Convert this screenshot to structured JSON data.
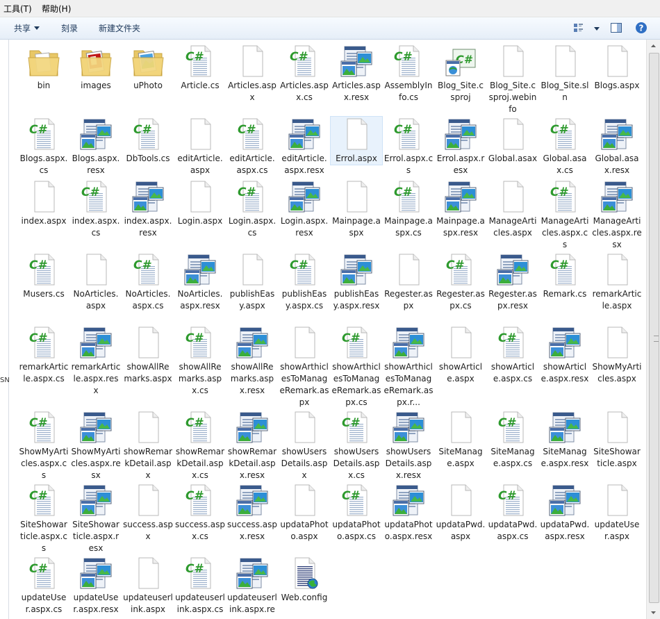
{
  "menu": {
    "tools": "工具(T)",
    "help": "帮助(H)"
  },
  "toolbar": {
    "share": "共享",
    "burn": "刻录",
    "new_folder": "新建文件夹"
  },
  "left_cut_text": "SN",
  "files": [
    {
      "name": "bin",
      "type": "folder"
    },
    {
      "name": "images",
      "type": "folder-images"
    },
    {
      "name": "uPhoto",
      "type": "folder-photo"
    },
    {
      "name": "Article.cs",
      "type": "cs"
    },
    {
      "name": "Articles.aspx",
      "type": "blank"
    },
    {
      "name": "Articles.aspx.cs",
      "type": "cs"
    },
    {
      "name": "Articles.aspx.resx",
      "type": "resx"
    },
    {
      "name": "AssemblyInfo.cs",
      "type": "cs"
    },
    {
      "name": "Blog_Site.csproj",
      "type": "csproj"
    },
    {
      "name": "Blog_Site.csproj.webinfo",
      "type": "blank"
    },
    {
      "name": "Blog_Site.sln",
      "type": "blank"
    },
    {
      "name": "Blogs.aspx",
      "type": "blank"
    },
    {
      "name": "Blogs.aspx.cs",
      "type": "cs"
    },
    {
      "name": "Blogs.aspx.resx",
      "type": "resx"
    },
    {
      "name": "DbTools.cs",
      "type": "cs"
    },
    {
      "name": "editArticle.aspx",
      "type": "blank"
    },
    {
      "name": "editArticle.aspx.cs",
      "type": "cs"
    },
    {
      "name": "editArticle.aspx.resx",
      "type": "resx"
    },
    {
      "name": "Errol.aspx",
      "type": "blank",
      "selected": true
    },
    {
      "name": "Errol.aspx.cs",
      "type": "cs"
    },
    {
      "name": "Errol.aspx.resx",
      "type": "resx"
    },
    {
      "name": "Global.asax",
      "type": "blank"
    },
    {
      "name": "Global.asax.cs",
      "type": "cs"
    },
    {
      "name": "Global.asax.resx",
      "type": "resx"
    },
    {
      "name": "index.aspx",
      "type": "blank"
    },
    {
      "name": "index.aspx.cs",
      "type": "cs"
    },
    {
      "name": "index.aspx.resx",
      "type": "resx"
    },
    {
      "name": "Login.aspx",
      "type": "blank"
    },
    {
      "name": "Login.aspx.cs",
      "type": "cs"
    },
    {
      "name": "Login.aspx.resx",
      "type": "resx"
    },
    {
      "name": "Mainpage.aspx",
      "type": "blank"
    },
    {
      "name": "Mainpage.aspx.cs",
      "type": "cs"
    },
    {
      "name": "Mainpage.aspx.resx",
      "type": "resx"
    },
    {
      "name": "ManageArticles.aspx",
      "type": "blank"
    },
    {
      "name": "ManageArticles.aspx.cs",
      "type": "cs"
    },
    {
      "name": "ManageArticles.aspx.resx",
      "type": "resx"
    },
    {
      "name": "Musers.cs",
      "type": "cs"
    },
    {
      "name": "NoArticles.aspx",
      "type": "blank"
    },
    {
      "name": "NoArticles.aspx.cs",
      "type": "cs"
    },
    {
      "name": "NoArticles.aspx.resx",
      "type": "resx"
    },
    {
      "name": "publishEasy.aspx",
      "type": "blank"
    },
    {
      "name": "publishEasy.aspx.cs",
      "type": "cs"
    },
    {
      "name": "publishEasy.aspx.resx",
      "type": "resx"
    },
    {
      "name": "Regester.aspx",
      "type": "blank"
    },
    {
      "name": "Regester.aspx.cs",
      "type": "cs"
    },
    {
      "name": "Regester.aspx.resx",
      "type": "resx"
    },
    {
      "name": "Remark.cs",
      "type": "cs"
    },
    {
      "name": "remarkArticle.aspx",
      "type": "blank"
    },
    {
      "name": "remarkArticle.aspx.cs",
      "type": "cs"
    },
    {
      "name": "remarkArticle.aspx.resx",
      "type": "resx"
    },
    {
      "name": "showAllRemarks.aspx",
      "type": "blank"
    },
    {
      "name": "showAllRemarks.aspx.cs",
      "type": "cs"
    },
    {
      "name": "showAllRemarks.aspx.resx",
      "type": "resx"
    },
    {
      "name": "showArthiclesToManageRemark.aspx",
      "type": "blank"
    },
    {
      "name": "showArthiclesToManageRemark.aspx.cs",
      "type": "cs"
    },
    {
      "name": "showArthiclesToManageRemark.aspx.r...",
      "type": "resx"
    },
    {
      "name": "showArticle.aspx",
      "type": "blank"
    },
    {
      "name": "showArticle.aspx.cs",
      "type": "cs"
    },
    {
      "name": "showArticle.aspx.resx",
      "type": "resx"
    },
    {
      "name": "ShowMyArticles.aspx",
      "type": "blank"
    },
    {
      "name": "ShowMyArticles.aspx.cs",
      "type": "cs"
    },
    {
      "name": "ShowMyArticles.aspx.resx",
      "type": "resx"
    },
    {
      "name": "showRemarkDetail.aspx",
      "type": "blank"
    },
    {
      "name": "showRemarkDetail.aspx.cs",
      "type": "cs"
    },
    {
      "name": "showRemarkDetail.aspx.resx",
      "type": "resx"
    },
    {
      "name": "showUsersDetails.aspx",
      "type": "blank"
    },
    {
      "name": "showUsersDetails.aspx.cs",
      "type": "cs"
    },
    {
      "name": "showUsersDetails.aspx.resx",
      "type": "resx"
    },
    {
      "name": "SiteManage.aspx",
      "type": "blank"
    },
    {
      "name": "SiteManage.aspx.cs",
      "type": "cs"
    },
    {
      "name": "SiteManage.aspx.resx",
      "type": "resx"
    },
    {
      "name": "SiteShowarticle.aspx",
      "type": "blank"
    },
    {
      "name": "SiteShowarticle.aspx.cs",
      "type": "cs"
    },
    {
      "name": "SiteShowarticle.aspx.resx",
      "type": "resx"
    },
    {
      "name": "success.aspx",
      "type": "blank"
    },
    {
      "name": "success.aspx.cs",
      "type": "cs"
    },
    {
      "name": "success.aspx.resx",
      "type": "resx"
    },
    {
      "name": "updataPhoto.aspx",
      "type": "blank"
    },
    {
      "name": "updataPhoto.aspx.cs",
      "type": "cs"
    },
    {
      "name": "updataPhoto.aspx.resx",
      "type": "resx"
    },
    {
      "name": "updataPwd.aspx",
      "type": "blank"
    },
    {
      "name": "updataPwd.aspx.cs",
      "type": "cs"
    },
    {
      "name": "updataPwd.aspx.resx",
      "type": "resx"
    },
    {
      "name": "updateUser.aspx",
      "type": "blank"
    },
    {
      "name": "updateUser.aspx.cs",
      "type": "cs"
    },
    {
      "name": "updateUser.aspx.resx",
      "type": "resx"
    },
    {
      "name": "updateuserlink.aspx",
      "type": "blank"
    },
    {
      "name": "updateuserlink.aspx.cs",
      "type": "cs"
    },
    {
      "name": "updateuserlink.aspx.resx",
      "type": "resx"
    },
    {
      "name": "Web.config",
      "type": "config"
    }
  ]
}
